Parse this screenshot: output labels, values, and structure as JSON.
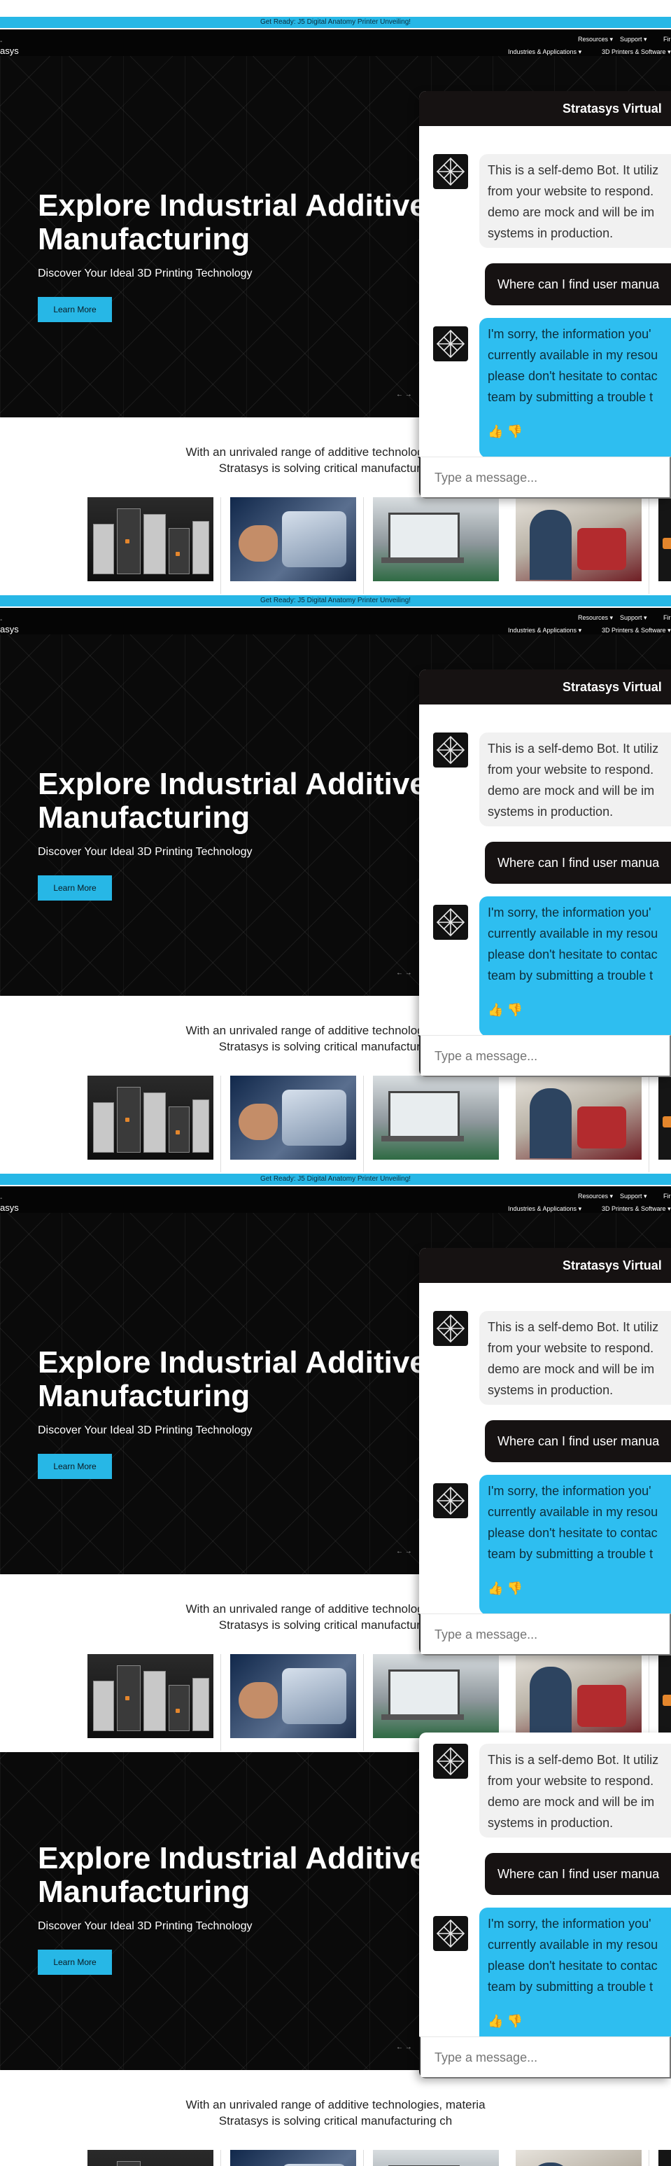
{
  "promo": {
    "text": "Get Ready: J5 Digital Anatomy Printer Unveiling!"
  },
  "top_nav": {
    "dash": "-",
    "resources": "Resources",
    "support": "Support",
    "find": "Fir",
    "industries": "Industries & Applications",
    "printers": "3D Printers & Software"
  },
  "logo": {
    "text": "asys"
  },
  "hero": {
    "title": "Explore Industrial Additive Manufacturing",
    "subtitle": "Discover Your Ideal 3D Printing Technology",
    "cta": "Learn More",
    "arrows": "←  →"
  },
  "tagline": {
    "line1": "With an unrivaled range of additive technologies, materia",
    "line2": "Stratasys is solving critical manufacturing ch"
  },
  "chat": {
    "header": "Stratasys Virtual",
    "intro_lines": [
      "This is a self-demo Bot. It utiliz",
      "from your website to respond.",
      "demo are mock and will be im",
      "systems in production."
    ],
    "user_message": "Where can I find user manua",
    "reply_lines": [
      "I'm sorry, the information you'",
      "currently available in my resou",
      "please don't hesitate to contac",
      "team by submitting a trouble t"
    ],
    "thumbs_up": "👍",
    "thumbs_down": "👎",
    "input_placeholder": "Type a message..."
  },
  "icons": {
    "chevron_down": "chevron-down-icon",
    "bot_logo": "stratasys-logo-icon",
    "thumbs_up": "thumbs-up-icon",
    "thumbs_down": "thumbs-down-icon"
  },
  "colors": {
    "accent": "#27b7e6",
    "dark": "#161212",
    "reply_bubble": "#2ebef0"
  }
}
